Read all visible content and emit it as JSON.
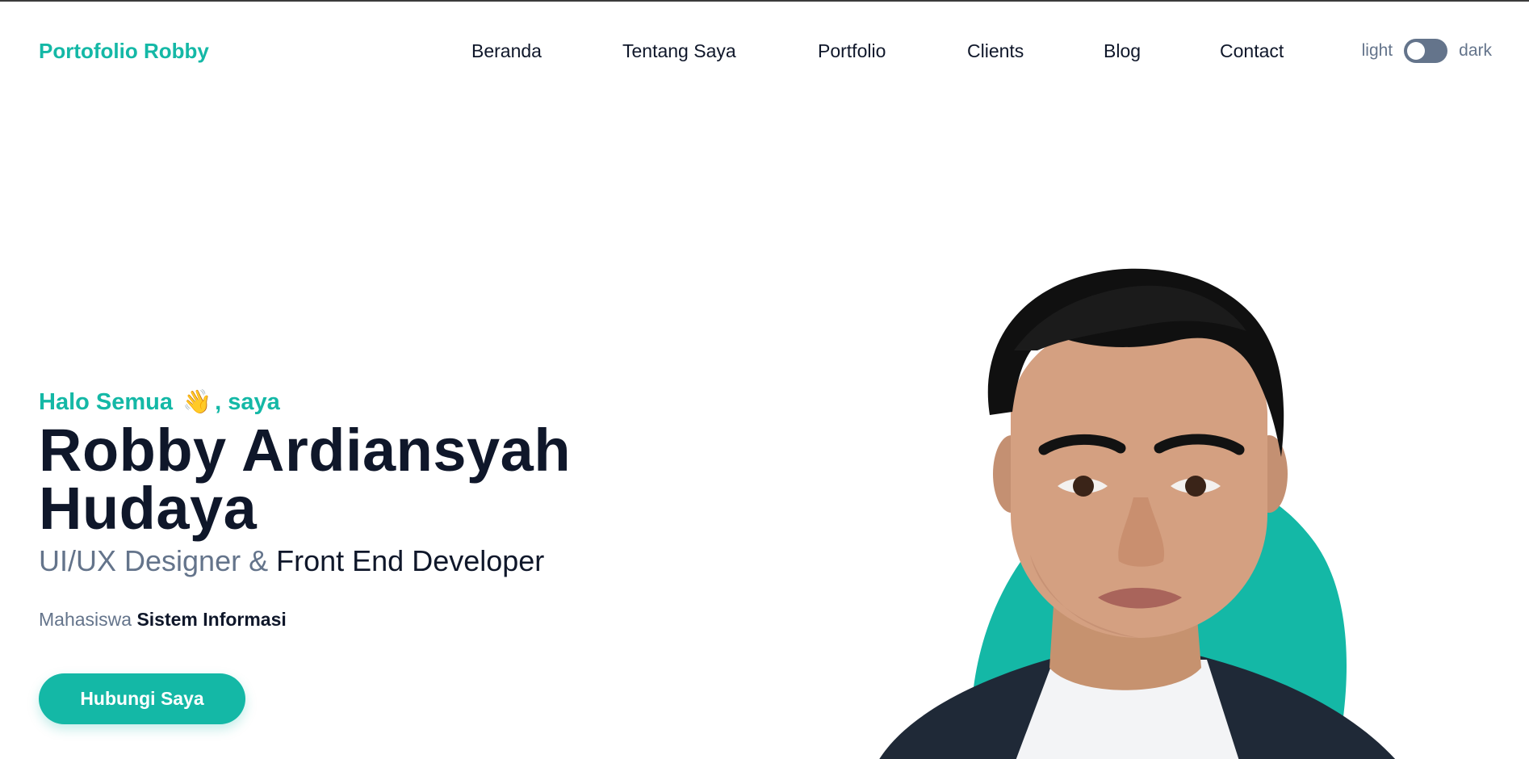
{
  "header": {
    "brand": "Portofolio Robby",
    "nav": [
      "Beranda",
      "Tentang Saya",
      "Portfolio",
      "Clients",
      "Blog",
      "Contact"
    ],
    "theme_light_label": "light",
    "theme_dark_label": "dark"
  },
  "hero": {
    "greeting_prefix": "Halo Semua",
    "greeting_emoji": "👋",
    "greeting_suffix": ", saya",
    "name": "Robby Ardiansyah Hudaya",
    "role_part1": "UI/UX Designer &",
    "role_part2": "Front End Developer",
    "desc_prefix": "Mahasiswa",
    "desc_strong": "Sistem Informasi",
    "cta_label": "Hubungi Saya"
  },
  "colors": {
    "accent": "#14b8a6",
    "text_dark": "#0f172a",
    "text_muted": "#64748b",
    "toggle_track": "#64748b"
  },
  "icons": {
    "toggle": "theme-toggle-switch",
    "wave": "waving-hand-icon"
  }
}
